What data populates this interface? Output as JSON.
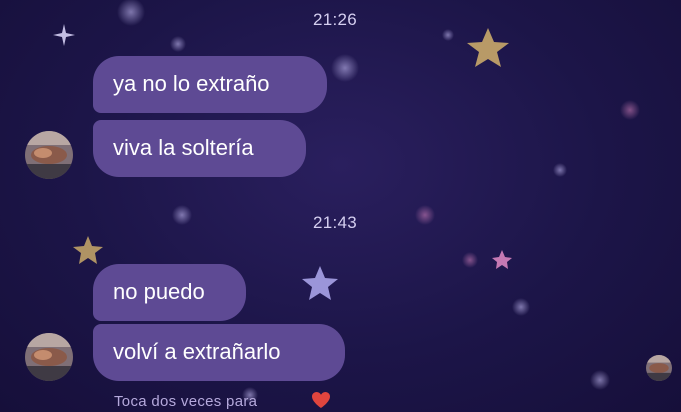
{
  "chat": {
    "groups": [
      {
        "time": "21:26",
        "messages": [
          "ya no lo extraño",
          "viva la soltería"
        ]
      },
      {
        "time": "21:43",
        "messages": [
          "no puedo",
          "volví a extrañarlo"
        ]
      }
    ],
    "hint": "Toca dos veces para",
    "reaction_icon": "heart-icon",
    "colors": {
      "background": "#1c1548",
      "bubble": "#5e4a94",
      "star": "#c9a96a",
      "heart": "#e0453e"
    }
  }
}
